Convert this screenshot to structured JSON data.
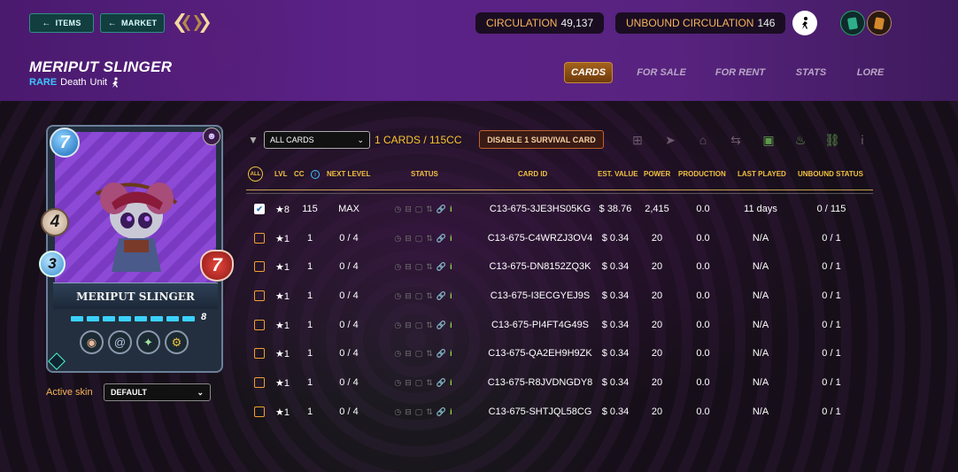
{
  "nav": {
    "items_label": "ITEMS",
    "market_label": "MARKET",
    "circulation_label": "CIRCULATION",
    "circulation_value": "49,137",
    "unbound_label": "UNBOUND CIRCULATION",
    "unbound_value": "146"
  },
  "card": {
    "title": "MERIPUT SLINGER",
    "rarity": "RARE",
    "element": "Death",
    "type": "Unit",
    "name_plate": "MERIPUT SLINGER",
    "mana": "7",
    "attack": "4",
    "speed": "3",
    "health": "7",
    "level": "8"
  },
  "tabs": [
    {
      "label": "CARDS",
      "active": true
    },
    {
      "label": "FOR SALE",
      "active": false
    },
    {
      "label": "FOR RENT",
      "active": false
    },
    {
      "label": "STATS",
      "active": false
    },
    {
      "label": "LORE",
      "active": false
    }
  ],
  "skin": {
    "label": "Active skin",
    "value": "DEFAULT"
  },
  "toolbar": {
    "filter_value": "ALL CARDS",
    "count_text": "1 CARDS / 115CC",
    "disable_label": "DISABLE 1 SURVIVAL CARD"
  },
  "table": {
    "all_label": "ALL",
    "headers": {
      "lvl": "LVL",
      "cc": "CC",
      "next_level": "NEXT LEVEL",
      "status": "STATUS",
      "card_id": "CARD ID",
      "est_value": "EST. VALUE",
      "power": "POWER",
      "production": "PRODUCTION",
      "last_played": "LAST PLAYED",
      "unbound": "UNBOUND STATUS"
    },
    "rows": [
      {
        "checked": true,
        "lvl": "★8",
        "cc": "115",
        "next": "MAX",
        "id": "C13-675-3JE3HS05KG",
        "value": "$ 38.76",
        "power": "2,415",
        "prod": "0.0",
        "last": "11 days",
        "unbound": "0 / 115"
      },
      {
        "checked": false,
        "lvl": "★1",
        "cc": "1",
        "next": "0 / 4",
        "id": "C13-675-C4WRZJ3OV4",
        "value": "$ 0.34",
        "power": "20",
        "prod": "0.0",
        "last": "N/A",
        "unbound": "0 / 1"
      },
      {
        "checked": false,
        "lvl": "★1",
        "cc": "1",
        "next": "0 / 4",
        "id": "C13-675-DN8152ZQ3K",
        "value": "$ 0.34",
        "power": "20",
        "prod": "0.0",
        "last": "N/A",
        "unbound": "0 / 1"
      },
      {
        "checked": false,
        "lvl": "★1",
        "cc": "1",
        "next": "0 / 4",
        "id": "C13-675-I3ECGYEJ9S",
        "value": "$ 0.34",
        "power": "20",
        "prod": "0.0",
        "last": "N/A",
        "unbound": "0 / 1"
      },
      {
        "checked": false,
        "lvl": "★1",
        "cc": "1",
        "next": "0 / 4",
        "id": "C13-675-PI4FT4G49S",
        "value": "$ 0.34",
        "power": "20",
        "prod": "0.0",
        "last": "N/A",
        "unbound": "0 / 1"
      },
      {
        "checked": false,
        "lvl": "★1",
        "cc": "1",
        "next": "0 / 4",
        "id": "C13-675-QA2EH9H9ZK",
        "value": "$ 0.34",
        "power": "20",
        "prod": "0.0",
        "last": "N/A",
        "unbound": "0 / 1"
      },
      {
        "checked": false,
        "lvl": "★1",
        "cc": "1",
        "next": "0 / 4",
        "id": "C13-675-R8JVDNGDY8",
        "value": "$ 0.34",
        "power": "20",
        "prod": "0.0",
        "last": "N/A",
        "unbound": "0 / 1"
      },
      {
        "checked": false,
        "lvl": "★1",
        "cc": "1",
        "next": "0 / 4",
        "id": "C13-675-SHTJQL58CG",
        "value": "$ 0.34",
        "power": "20",
        "prod": "0.0",
        "last": "N/A",
        "unbound": "0 / 1"
      }
    ]
  },
  "colors": {
    "accent_gold": "#f0c040",
    "rare_blue": "#3dc5ff",
    "header_purple": "#5b2288"
  }
}
